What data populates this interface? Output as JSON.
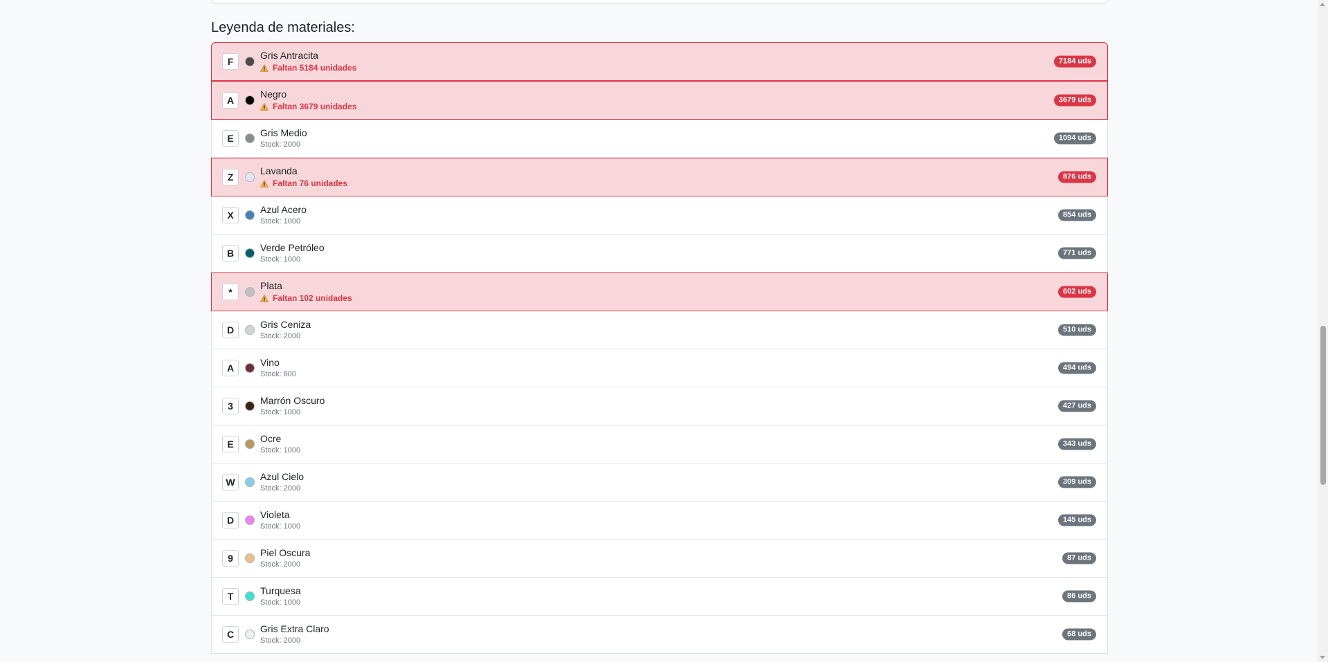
{
  "legend": {
    "title": "Leyenda de materiales:"
  },
  "materials": [
    {
      "letter": "F",
      "name": "Gris Antracita",
      "color": "#4a4a4a",
      "alert": true,
      "status": "Faltan 5184 unidades",
      "badge": "7184 uds"
    },
    {
      "letter": "A",
      "name": "Negro",
      "color": "#000000",
      "alert": true,
      "status": "Faltan 3679 unidades",
      "badge": "3679 uds"
    },
    {
      "letter": "E",
      "name": "Gris Medio",
      "color": "#8a8a8a",
      "alert": false,
      "status": "Stock: 2000",
      "badge": "1094 uds"
    },
    {
      "letter": "Z",
      "name": "Lavanda",
      "color": "#e6e6fa",
      "alert": true,
      "status": "Faltan 76 unidades",
      "badge": "876 uds"
    },
    {
      "letter": "X",
      "name": "Azul Acero",
      "color": "#4682b4",
      "alert": false,
      "status": "Stock: 1000",
      "badge": "854 uds"
    },
    {
      "letter": "B",
      "name": "Verde Petróleo",
      "color": "#005f6a",
      "alert": false,
      "status": "Stock: 1000",
      "badge": "771 uds"
    },
    {
      "letter": "*",
      "name": "Plata",
      "color": "#c0c0c0",
      "alert": true,
      "status": "Faltan 102 unidades",
      "badge": "602 uds"
    },
    {
      "letter": "D",
      "name": "Gris Ceniza",
      "color": "#d4d4d4",
      "alert": false,
      "status": "Stock: 2000",
      "badge": "510 uds"
    },
    {
      "letter": "A",
      "name": "Vino",
      "color": "#722f37",
      "alert": false,
      "status": "Stock: 800",
      "badge": "494 uds"
    },
    {
      "letter": "3",
      "name": "Marrón Oscuro",
      "color": "#3d2314",
      "alert": false,
      "status": "Stock: 1000",
      "badge": "427 uds"
    },
    {
      "letter": "E",
      "name": "Ocre",
      "color": "#b89a5a",
      "alert": false,
      "status": "Stock: 1000",
      "badge": "343 uds"
    },
    {
      "letter": "W",
      "name": "Azul Cielo",
      "color": "#87ceeb",
      "alert": false,
      "status": "Stock: 2000",
      "badge": "309 uds"
    },
    {
      "letter": "D",
      "name": "Violeta",
      "color": "#ee82ee",
      "alert": false,
      "status": "Stock: 1000",
      "badge": "145 uds"
    },
    {
      "letter": "9",
      "name": "Piel Oscura",
      "color": "#e8c08a",
      "alert": false,
      "status": "Stock: 2000",
      "badge": "87 uds"
    },
    {
      "letter": "T",
      "name": "Turquesa",
      "color": "#40e0d0",
      "alert": false,
      "status": "Stock: 1000",
      "badge": "86 uds"
    },
    {
      "letter": "C",
      "name": "Gris Extra Claro",
      "color": "#efefef",
      "alert": false,
      "status": "Stock: 2000",
      "badge": "68 uds"
    }
  ],
  "icons": {
    "warning": "warning-icon"
  },
  "colors": {
    "alert_bg": "#f8d7da",
    "alert_border": "#dc3545",
    "alert_text": "#dc3545",
    "badge_default": "#6c757d",
    "badge_alert": "#dc3545"
  }
}
